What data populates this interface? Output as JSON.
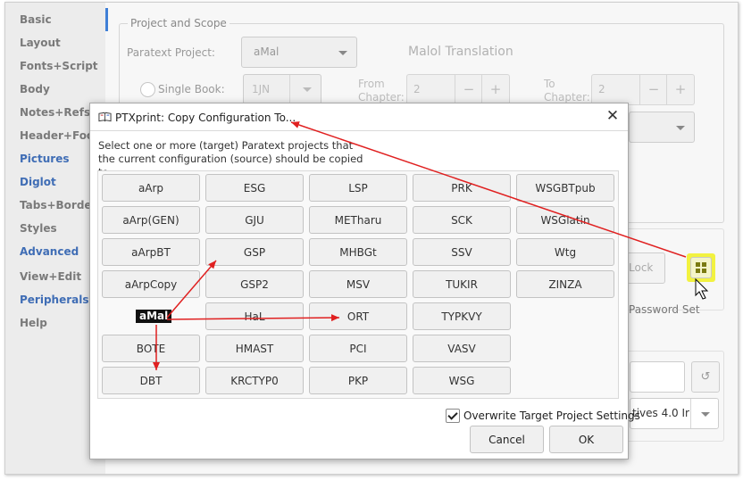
{
  "sidebar": {
    "items": [
      {
        "label": "Basic"
      },
      {
        "label": "Layout"
      },
      {
        "label": "Fonts+Script"
      },
      {
        "label": "Body"
      },
      {
        "label": "Notes+Refs"
      },
      {
        "label": "Header+Footer"
      },
      {
        "label": "Pictures"
      },
      {
        "label": "Diglot"
      },
      {
        "label": "Tabs+Borders"
      },
      {
        "label": "Styles"
      },
      {
        "label": "Advanced"
      },
      {
        "label": "View+Edit"
      },
      {
        "label": "Peripherals"
      },
      {
        "label": "Help"
      }
    ]
  },
  "background": {
    "scope_legend": "Project and Scope",
    "project_label": "Paratext Project:",
    "project_value": "aMal",
    "project_name": "Malol Translation",
    "single_book_label": "Single Book:",
    "book_value": "1JN",
    "from_label_1": "From",
    "from_label_2": "Chapter:",
    "from_value": "2",
    "to_label_1": "To",
    "to_label_2": "Chapter:",
    "to_value": "2",
    "lock_label": "Lock",
    "password_label": "Password Set",
    "license_text": "tives 4.0 Ir"
  },
  "dialog": {
    "title": "PTXprint: Copy Configuration To...",
    "description": "Select one or more (target) Paratext projects that the current configuration (source) should be copied to:",
    "current_project": "aMal",
    "projects": [
      {
        "label": "aArp"
      },
      {
        "label": "ESG"
      },
      {
        "label": "LSP"
      },
      {
        "label": "PRK"
      },
      {
        "label": "WSGBTpub"
      },
      {
        "label": "aArp(GEN)"
      },
      {
        "label": "GJU"
      },
      {
        "label": "METharu"
      },
      {
        "label": "SCK"
      },
      {
        "label": "WSGlatin"
      },
      {
        "label": "aArpBT"
      },
      {
        "label": "GSP"
      },
      {
        "label": "MHBGt"
      },
      {
        "label": "SSV"
      },
      {
        "label": "Wtg"
      },
      {
        "label": "aArpCopy"
      },
      {
        "label": "GSP2"
      },
      {
        "label": "MSV"
      },
      {
        "label": "TUKIR"
      },
      {
        "label": "ZINZA"
      },
      {
        "label": "HaL"
      },
      {
        "label": "ORT"
      },
      {
        "label": "TYPKVY"
      },
      {
        "label": "BOTE"
      },
      {
        "label": "HMAST"
      },
      {
        "label": "PCI"
      },
      {
        "label": "VASV"
      },
      {
        "label": "DBT"
      },
      {
        "label": "KRCTYP0"
      },
      {
        "label": "PKP"
      },
      {
        "label": "WSG"
      }
    ],
    "overwrite_label": "Overwrite Target Project Settings",
    "overwrite_checked": true,
    "cancel_label": "Cancel",
    "ok_label": "OK"
  },
  "colors": {
    "accent": "#3f6db5",
    "highlight": "#f2f240",
    "arrow": "#e02020"
  },
  "icons": [
    "book-icon",
    "close-icon",
    "grid-icon",
    "cursor-icon",
    "refresh-icon",
    "chevron-down-icon",
    "plus-icon",
    "minus-icon"
  ]
}
